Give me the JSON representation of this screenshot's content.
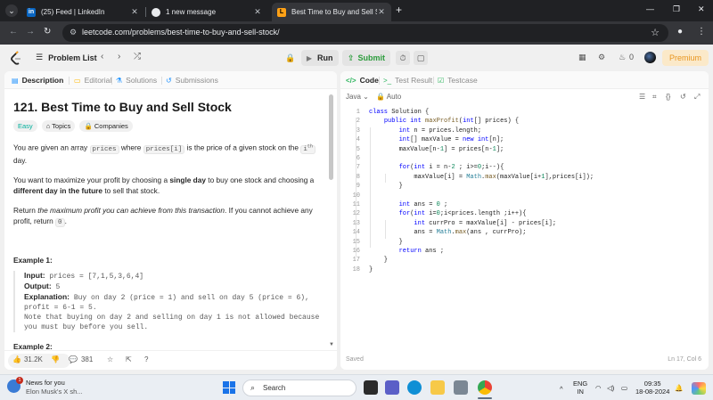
{
  "browser": {
    "tabs": [
      {
        "title": "(25) Feed | LinkedIn",
        "favicon": "in",
        "active": false
      },
      {
        "title": "1 new message",
        "active": false
      },
      {
        "title": "Best Time to Buy and Sell Stock",
        "active": true
      }
    ],
    "url": "leetcode.com/problems/best-time-to-buy-and-sell-stock/"
  },
  "nav": {
    "problem_list": "Problem List",
    "run": "Run",
    "submit": "Submit",
    "streak": "0",
    "premium": "Premium"
  },
  "left": {
    "tabs": [
      "Description",
      "Editorial",
      "Solutions",
      "Submissions"
    ],
    "title": "121. Best Time to Buy and Sell Stock",
    "difficulty": "Easy",
    "chips": [
      "Topics",
      "Companies"
    ],
    "p1": {
      "a": "You are given an array ",
      "code1": "prices",
      "b": " where ",
      "code2": "prices[i]",
      "c": " is the price of a given stock on the ",
      "sup_pre": "i",
      "sup": "th",
      "d": " day."
    },
    "p2": {
      "a": "You want to maximize your profit by choosing a ",
      "b1": "single day",
      "b": " to buy one stock and choosing a ",
      "b2": "different day in the future",
      "c": " to sell that stock."
    },
    "p3": {
      "a": "Return ",
      "em": "the maximum profit you can achieve from this transaction",
      "b": ". If you cannot achieve any profit, return ",
      "code": "0",
      "c": "."
    },
    "example1": {
      "heading": "Example 1:",
      "input_label": "Input:",
      "input": "prices = [7,1,5,3,6,4]",
      "output_label": "Output:",
      "output": "5",
      "explanation_label": "Explanation:",
      "explanation": "Buy on day 2 (price = 1) and sell on day 5 (price = 6), profit = 6-1 = 5.",
      "note": "Note that buying on day 2 and selling on day 1 is not allowed because you must buy before you sell."
    },
    "example2_heading": "Example 2:",
    "likes": "31.2K",
    "comments": "381"
  },
  "editor": {
    "tabs": [
      "Code",
      "Test Result",
      "Testcase"
    ],
    "language": "Java",
    "mode": "Auto",
    "status": "Saved",
    "cursor": "Ln 17, Col 6",
    "lines": [
      "class Solution {",
      "    public int maxProfit(int[] prices) {",
      "        int n = prices.length;",
      "        int[] maxValue = new int[n];",
      "        maxValue[n-1] = prices[n-1];",
      "",
      "        for(int i = n-2 ; i>=0;i--){",
      "            maxValue[i] = Math.max(maxValue[i+1],prices[i]);",
      "        }",
      "",
      "        int ans = 0 ;",
      "        for(int i=0;i<prices.length ;i++){",
      "            int currPro = maxValue[i] - prices[i];",
      "            ans = Math.max(ans , currPro);",
      "        }",
      "        return ans ;",
      "    }",
      "}"
    ]
  },
  "taskbar": {
    "news_title": "News for you",
    "news_sub": "Elon Musk's X sh...",
    "news_badge": "1",
    "search": "Search",
    "lang1": "ENG",
    "lang2": "IN",
    "time": "09:35",
    "date": "18-08-2024"
  }
}
